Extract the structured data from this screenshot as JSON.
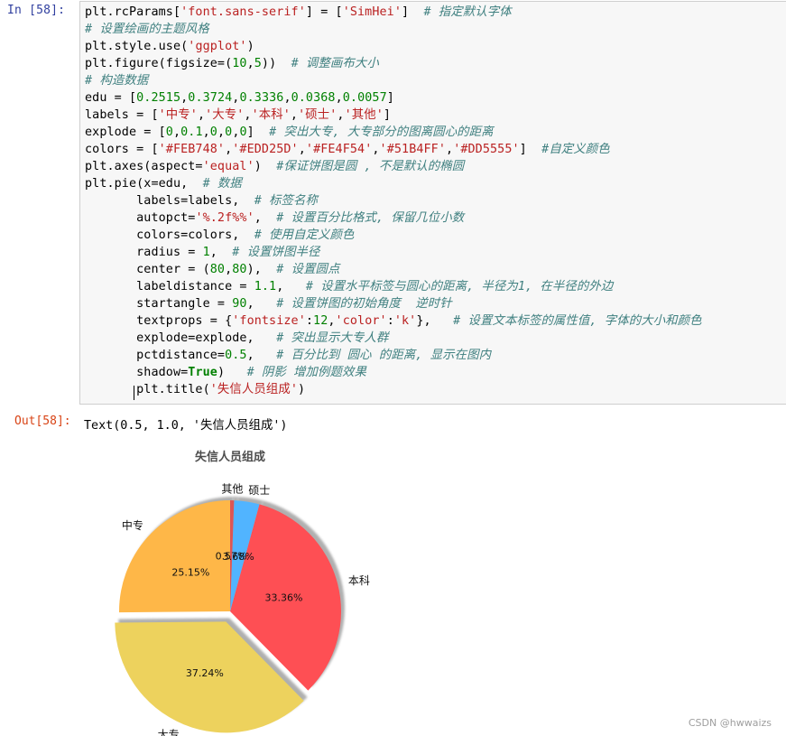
{
  "input_cell": {
    "prompt": "In  [58]:",
    "lines": [
      [
        [
          "t",
          "plt.rcParams["
        ],
        [
          "s",
          "'font.sans-serif'"
        ],
        [
          "t",
          "] = ["
        ],
        [
          "s",
          "'SimHei'"
        ],
        [
          "t",
          "]  "
        ],
        [
          "c",
          "# 指定默认字体"
        ]
      ],
      [
        [
          "c",
          "# 设置绘画的主题风格"
        ]
      ],
      [
        [
          "t",
          "plt.style.use("
        ],
        [
          "s",
          "'ggplot'"
        ],
        [
          "t",
          ")"
        ]
      ],
      [
        [
          "t",
          "plt.figure(figsize=("
        ],
        [
          "n",
          "10"
        ],
        [
          "t",
          ","
        ],
        [
          "n",
          "5"
        ],
        [
          "t",
          "))  "
        ],
        [
          "c",
          "# 调整画布大小"
        ]
      ],
      [
        [
          "c",
          "# 构造数据"
        ]
      ],
      [
        [
          "t",
          "edu = ["
        ],
        [
          "n",
          "0.2515"
        ],
        [
          "t",
          ","
        ],
        [
          "n",
          "0.3724"
        ],
        [
          "t",
          ","
        ],
        [
          "n",
          "0.3336"
        ],
        [
          "t",
          ","
        ],
        [
          "n",
          "0.0368"
        ],
        [
          "t",
          ","
        ],
        [
          "n",
          "0.0057"
        ],
        [
          "t",
          "]"
        ]
      ],
      [
        [
          "t",
          "labels = ["
        ],
        [
          "s",
          "'中专'"
        ],
        [
          "t",
          ","
        ],
        [
          "s",
          "'大专'"
        ],
        [
          "t",
          ","
        ],
        [
          "s",
          "'本科'"
        ],
        [
          "t",
          ","
        ],
        [
          "s",
          "'硕士'"
        ],
        [
          "t",
          ","
        ],
        [
          "s",
          "'其他'"
        ],
        [
          "t",
          "]"
        ]
      ],
      [
        [
          "t",
          "explode = ["
        ],
        [
          "n",
          "0"
        ],
        [
          "t",
          ","
        ],
        [
          "n",
          "0.1"
        ],
        [
          "t",
          ","
        ],
        [
          "n",
          "0"
        ],
        [
          "t",
          ","
        ],
        [
          "n",
          "0"
        ],
        [
          "t",
          ","
        ],
        [
          "n",
          "0"
        ],
        [
          "t",
          "]  "
        ],
        [
          "c",
          "# 突出大专, 大专部分的图离圆心的距离"
        ]
      ],
      [
        [
          "t",
          "colors = ["
        ],
        [
          "s",
          "'#FEB748'"
        ],
        [
          "t",
          ","
        ],
        [
          "s",
          "'#EDD25D'"
        ],
        [
          "t",
          ","
        ],
        [
          "s",
          "'#FE4F54'"
        ],
        [
          "t",
          ","
        ],
        [
          "s",
          "'#51B4FF'"
        ],
        [
          "t",
          ","
        ],
        [
          "s",
          "'#DD5555'"
        ],
        [
          "t",
          "]  "
        ],
        [
          "c",
          "#自定义颜色"
        ]
      ],
      [
        [
          "t",
          "plt.axes(aspect="
        ],
        [
          "s",
          "'equal'"
        ],
        [
          "t",
          ")  "
        ],
        [
          "c",
          "#保证饼图是圆 , 不是默认的椭圆"
        ]
      ],
      [
        [
          "t",
          "plt.pie(x=edu,  "
        ],
        [
          "c",
          "# 数据"
        ]
      ],
      [
        [
          "t",
          "       labels=labels,  "
        ],
        [
          "c",
          "# 标签名称"
        ]
      ],
      [
        [
          "t",
          "       autopct="
        ],
        [
          "s",
          "'%.2f%%'"
        ],
        [
          "t",
          ",  "
        ],
        [
          "c",
          "# 设置百分比格式, 保留几位小数"
        ]
      ],
      [
        [
          "t",
          "       colors=colors,  "
        ],
        [
          "c",
          "# 使用自定义颜色"
        ]
      ],
      [
        [
          "t",
          "       radius = "
        ],
        [
          "n",
          "1"
        ],
        [
          "t",
          ",  "
        ],
        [
          "c",
          "# 设置饼图半径"
        ]
      ],
      [
        [
          "t",
          "       center = ("
        ],
        [
          "n",
          "80"
        ],
        [
          "t",
          ","
        ],
        [
          "n",
          "80"
        ],
        [
          "t",
          "),  "
        ],
        [
          "c",
          "# 设置圆点"
        ]
      ],
      [
        [
          "t",
          "       labeldistance = "
        ],
        [
          "n",
          "1.1"
        ],
        [
          "t",
          ",   "
        ],
        [
          "c",
          "# 设置水平标签与圆心的距离, 半径为1, 在半径的外边"
        ]
      ],
      [
        [
          "t",
          "       startangle = "
        ],
        [
          "n",
          "90"
        ],
        [
          "t",
          ",   "
        ],
        [
          "c",
          "# 设置饼图的初始角度  逆时针"
        ]
      ],
      [
        [
          "t",
          "       textprops = {"
        ],
        [
          "s",
          "'fontsize'"
        ],
        [
          "t",
          ":"
        ],
        [
          "n",
          "12"
        ],
        [
          "t",
          ","
        ],
        [
          "s",
          "'color'"
        ],
        [
          "t",
          ":"
        ],
        [
          "s",
          "'k'"
        ],
        [
          "t",
          "},   "
        ],
        [
          "c",
          "# 设置文本标签的属性值, 字体的大小和颜色"
        ]
      ],
      [
        [
          "t",
          "       explode=explode,   "
        ],
        [
          "c",
          "# 突出显示大专人群"
        ]
      ],
      [
        [
          "t",
          "       pctdistance="
        ],
        [
          "n",
          "0.5"
        ],
        [
          "t",
          ",   "
        ],
        [
          "c",
          "# 百分比到 圆心 的距离, 显示在图内"
        ]
      ],
      [
        [
          "t",
          "       shadow="
        ],
        [
          "k",
          "True"
        ],
        [
          "t",
          ")   "
        ],
        [
          "c",
          "# 阴影 增加例题效果"
        ]
      ],
      [
        [
          "t",
          "       plt.title("
        ],
        [
          "s",
          "'失信人员组成'"
        ],
        [
          "t",
          ")"
        ]
      ]
    ]
  },
  "output_cell": {
    "prompt": "Out[58]:",
    "text": "Text(0.5, 1.0, '失信人员组成')"
  },
  "chart_data": {
    "type": "pie",
    "title": "失信人员组成",
    "categories": [
      "中专",
      "大专",
      "本科",
      "硕士",
      "其他"
    ],
    "values": [
      0.2515,
      0.3724,
      0.3336,
      0.0368,
      0.0057
    ],
    "percent_labels": [
      "25.15%",
      "37.24%",
      "33.36%",
      "3.68%",
      "0.57%"
    ],
    "colors": [
      "#FEB748",
      "#EDD25D",
      "#FE4F54",
      "#51B4FF",
      "#DD5555"
    ],
    "explode": [
      0,
      0.1,
      0,
      0,
      0
    ],
    "startangle": 90,
    "counterclockwise": true,
    "shadow": true
  },
  "watermark": "CSDN @hwwaizs"
}
